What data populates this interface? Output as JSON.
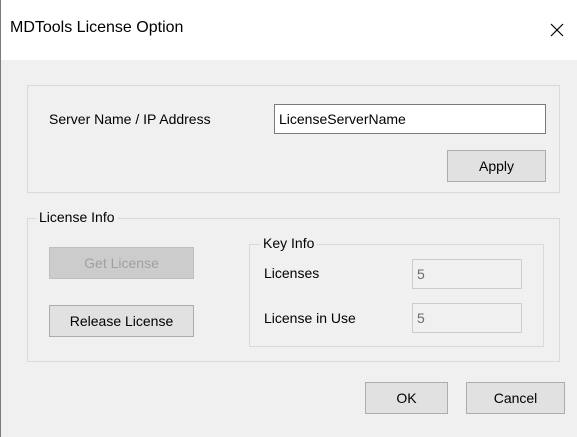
{
  "window": {
    "title": "MDTools License Option",
    "close_glyph": "✕"
  },
  "server": {
    "label": "Server Name / IP Address",
    "value": "LicenseServerName",
    "apply_label": "Apply"
  },
  "license_info": {
    "legend": "License Info",
    "get_license_label": "Get License",
    "release_license_label": "Release License",
    "key_info": {
      "legend": "Key Info",
      "licenses_label": "Licenses",
      "licenses_value": "5",
      "in_use_label": "License in Use",
      "in_use_value": "5"
    }
  },
  "footer": {
    "ok_label": "OK",
    "cancel_label": "Cancel"
  },
  "icons": {
    "close": "close-icon"
  }
}
